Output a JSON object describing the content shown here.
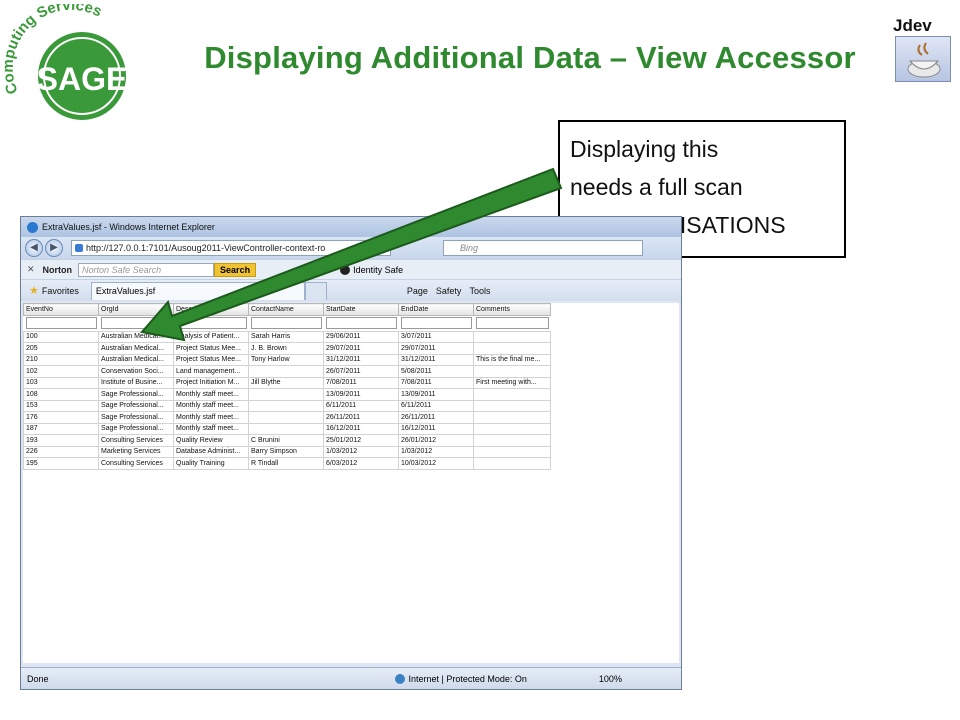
{
  "slide": {
    "title": "Displaying Additional Data – View Accessor",
    "logo": {
      "text_top": "Computing Services",
      "text_main": "SAGE"
    },
    "jdev_label": "Jdev",
    "callout": [
      "Displaying this",
      "needs a full scan",
      "of ORGANISATIONS"
    ],
    "colors": {
      "title": "#2f8a2f",
      "logo": "#3a9a3a",
      "arrow": "#2f8a2f"
    }
  },
  "browser": {
    "window_title": "ExtraValues.jsf - Windows Internet Explorer",
    "address": "http://127.0.0.1:7101/Ausoug2011-ViewController-context-ro",
    "search_placeholder": "Bing",
    "norton": {
      "label": "Norton",
      "search_placeholder": "Norton Safe Search",
      "search_button": "Search",
      "identity_safe": "Identity Safe"
    },
    "favorites": "Favorites",
    "tab_title": "ExtraValues.jsf",
    "commands": [
      "Page",
      "Safety",
      "Tools"
    ],
    "status_left": "Done",
    "status_zone": "Internet | Protected Mode: On",
    "zoom": "100%"
  },
  "table": {
    "columns": [
      "EventNo",
      "OrgId",
      "Description",
      "ContactName",
      "StartDate",
      "EndDate",
      "Comments"
    ],
    "rows": [
      [
        "100",
        "Australian Medical...",
        "Analysis of Patient...",
        "Sarah Harris",
        "29/06/2011",
        "3/07/2011",
        ""
      ],
      [
        "205",
        "Australian Medical...",
        "Project Status Mee...",
        "J. B. Brown",
        "29/07/2011",
        "29/07/2011",
        ""
      ],
      [
        "210",
        "Australian Medical...",
        "Project Status Mee...",
        "Tony Harlow",
        "31/12/2011",
        "31/12/2011",
        "This is the final me..."
      ],
      [
        "102",
        "Conservation Soci...",
        "Land management...",
        "",
        "26/07/2011",
        "5/08/2011",
        ""
      ],
      [
        "103",
        "Institute of Busine...",
        "Project Initiation M...",
        "Jill Blythe",
        "7/08/2011",
        "7/08/2011",
        "First meeting with..."
      ],
      [
        "108",
        "Sage Professional...",
        "Monthly staff meet...",
        "",
        "13/09/2011",
        "13/09/2011",
        ""
      ],
      [
        "153",
        "Sage Professional...",
        "Monthly staff meet...",
        "",
        "6/11/2011",
        "6/11/2011",
        ""
      ],
      [
        "176",
        "Sage Professional...",
        "Monthly staff meet...",
        "",
        "26/11/2011",
        "26/11/2011",
        ""
      ],
      [
        "187",
        "Sage Professional...",
        "Monthly staff meet...",
        "",
        "16/12/2011",
        "16/12/2011",
        ""
      ],
      [
        "193",
        "Consulting Services",
        "Quality Review",
        "C Brunini",
        "25/01/2012",
        "26/01/2012",
        ""
      ],
      [
        "226",
        "Marketing Services",
        "Database Administ...",
        "Barry Simpson",
        "1/03/2012",
        "1/03/2012",
        ""
      ],
      [
        "195",
        "Consulting Services",
        "Quality Training",
        "R Tindall",
        "6/03/2012",
        "10/03/2012",
        ""
      ]
    ]
  }
}
